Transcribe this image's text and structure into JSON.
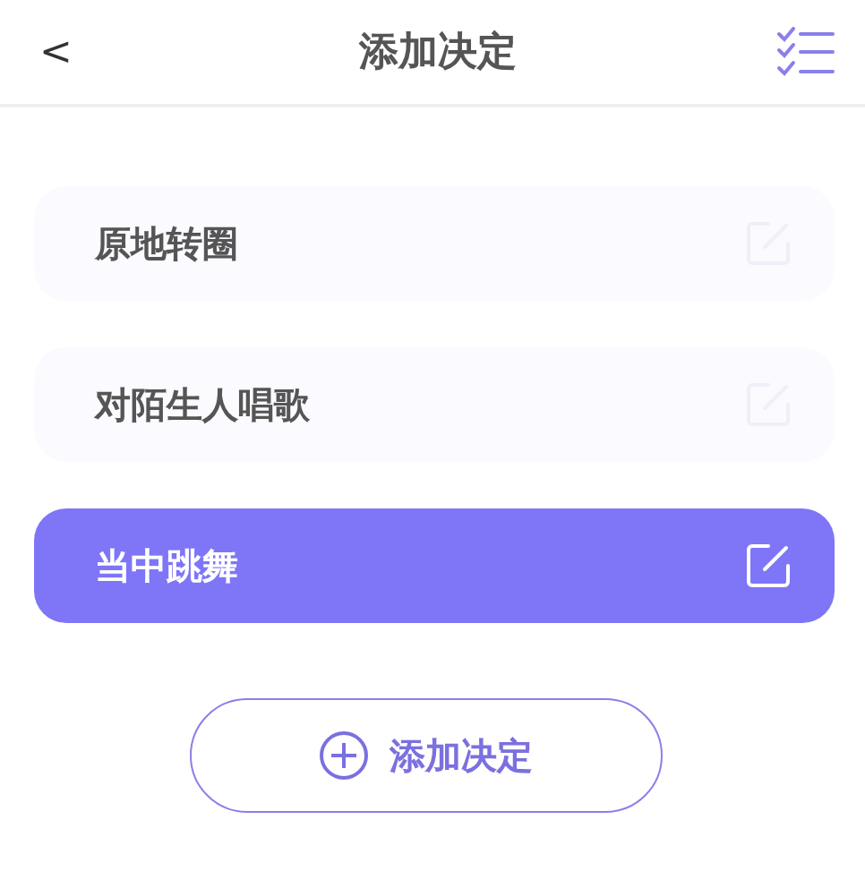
{
  "header": {
    "back": "<",
    "title": "添加决定"
  },
  "decisions": [
    {
      "label": "原地转圈",
      "selected": false
    },
    {
      "label": "对陌生人唱歌",
      "selected": false
    },
    {
      "label": "当中跳舞",
      "selected": true
    }
  ],
  "add_button": {
    "label": "添加决定"
  }
}
